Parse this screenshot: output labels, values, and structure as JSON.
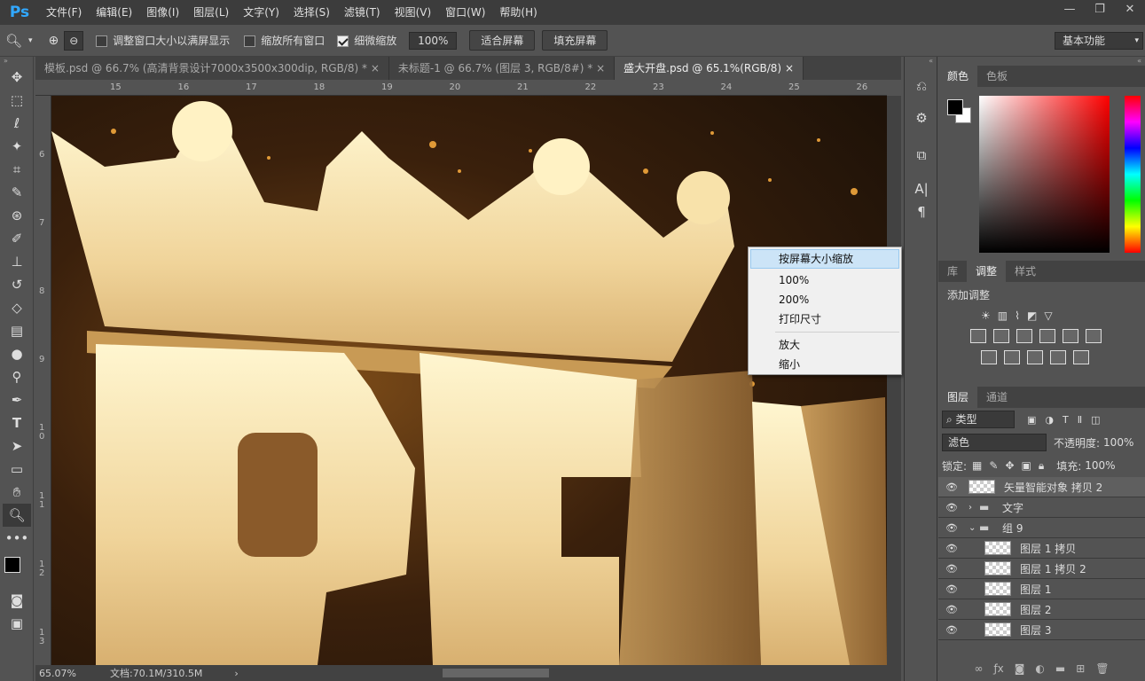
{
  "app": {
    "logo": "Ps"
  },
  "menu": [
    "文件(F)",
    "编辑(E)",
    "图像(I)",
    "图层(L)",
    "文字(Y)",
    "选择(S)",
    "滤镜(T)",
    "视图(V)",
    "窗口(W)",
    "帮助(H)"
  ],
  "window_controls": {
    "minimize": "—",
    "restore": "❐",
    "close": "✕"
  },
  "options": {
    "resize_windows": "调整窗口大小以满屏显示",
    "zoom_all": "缩放所有窗口",
    "scrubby_zoom": "细微缩放",
    "zoom_value": "100%",
    "fit_screen": "适合屏幕",
    "fill_screen": "填充屏幕",
    "workspace": "基本功能"
  },
  "tabs": [
    {
      "label": "模板.psd @ 66.7% (高清背景设计7000x3500x300dip, RGB/8) *"
    },
    {
      "label": "未标题-1 @ 66.7% (图层 3, RGB/8#) *"
    },
    {
      "label": "盛大开盘.psd @ 65.1%(RGB/8)"
    }
  ],
  "tab_close": "×",
  "ruler_top": [
    "15",
    "16",
    "17",
    "18",
    "19",
    "20",
    "21",
    "22",
    "23",
    "24",
    "25",
    "26"
  ],
  "ruler_left": [
    "6",
    "7",
    "8",
    "9",
    "10",
    "11",
    "12",
    "13"
  ],
  "status": {
    "zoom": "65.07%",
    "doc": "文档:70.1M/310.5M",
    "arrow": "›"
  },
  "context_menu": {
    "items": [
      "按屏幕大小缩放",
      "100%",
      "200%",
      "打印尺寸"
    ],
    "items2": [
      "放大",
      "缩小"
    ]
  },
  "color_panel": {
    "tabs": [
      "颜色",
      "色板"
    ]
  },
  "adjust_panel": {
    "tabs": [
      "库",
      "调整",
      "样式"
    ],
    "title": "添加调整"
  },
  "layers_panel": {
    "tabs": [
      "图层",
      "通道"
    ],
    "filter": "类型",
    "blend": "滤色",
    "opacity_label": "不透明度:",
    "opacity": "100%",
    "lock_label": "锁定:",
    "fill_label": "填充:",
    "fill": "100%",
    "layers": [
      {
        "name": "矢量智能对象 拷贝 2",
        "type": "layer"
      },
      {
        "name": "文字",
        "type": "group-closed"
      },
      {
        "name": "组 9",
        "type": "group-open"
      },
      {
        "name": "图层 1 拷贝",
        "type": "layer"
      },
      {
        "name": "图层 1 拷贝 2",
        "type": "layer"
      },
      {
        "name": "图层 1",
        "type": "layer"
      },
      {
        "name": "图层 2",
        "type": "layer"
      },
      {
        "name": "图层 3",
        "type": "layer"
      }
    ]
  },
  "canvas_art": {
    "letters": "PEN"
  }
}
